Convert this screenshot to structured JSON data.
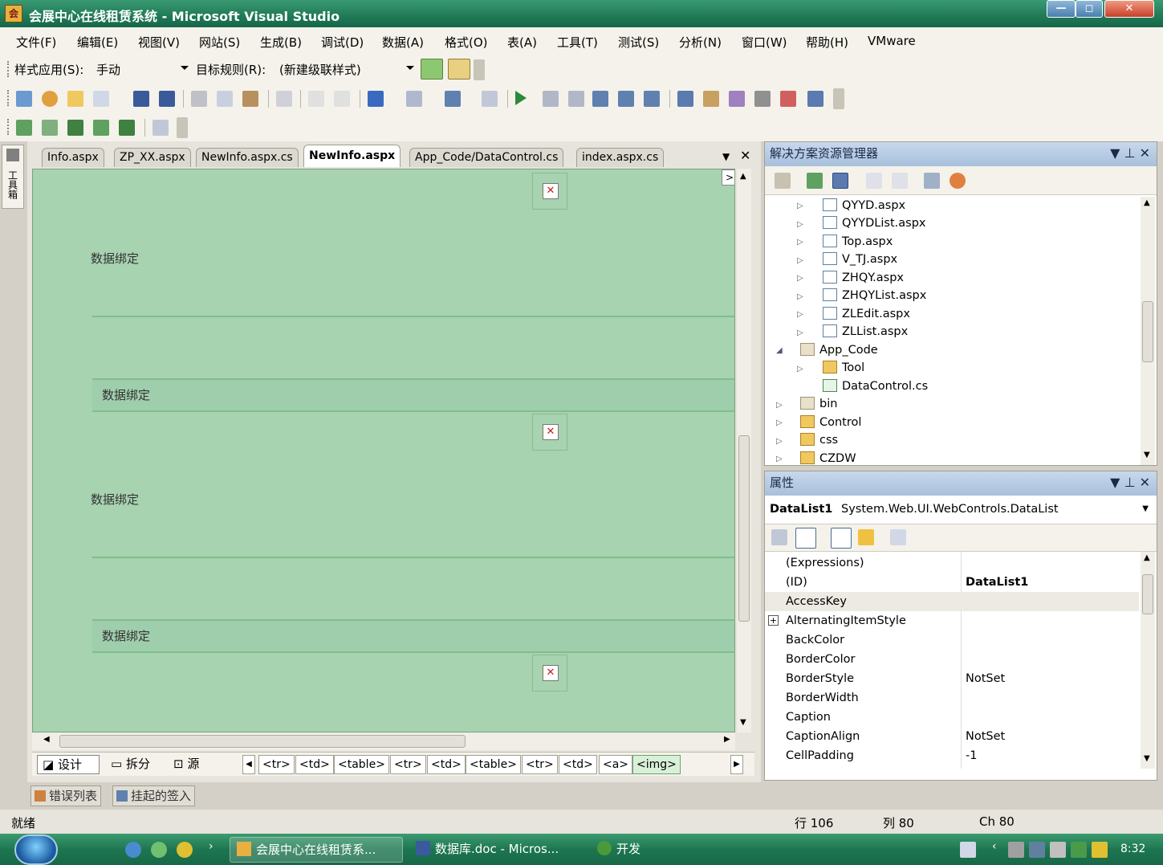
{
  "window": {
    "title": "会展中心在线租赁系统 - Microsoft Visual Studio",
    "icon_glyph": "会"
  },
  "window_buttons": {
    "minimize": "—",
    "maximize": "◻",
    "close": "✕"
  },
  "menu": [
    "文件(F)",
    "编辑(E)",
    "视图(V)",
    "网站(S)",
    "生成(B)",
    "调试(D)",
    "数据(A)",
    "格式(O)",
    "表(A)",
    "工具(T)",
    "测试(S)",
    "分析(N)",
    "窗口(W)",
    "帮助(H)",
    "VMware"
  ],
  "style_toolbar": {
    "style_apply_label": "样式应用(S):",
    "style_apply_value": "手动",
    "target_rule_label": "目标规则(R):",
    "target_rule_value": "(新建级联样式)"
  },
  "toolbox_strip": {
    "icon": "toolbox-icon",
    "label": "工具箱"
  },
  "doc_tabs": [
    {
      "label": "Info.aspx",
      "active": false
    },
    {
      "label": "ZP_XX.aspx",
      "active": false
    },
    {
      "label": "NewInfo.aspx.cs",
      "active": false
    },
    {
      "label": "NewInfo.aspx",
      "active": true
    },
    {
      "label": "App_Code/DataControl.cs",
      "active": false
    },
    {
      "label": "index.aspx.cs",
      "active": false
    }
  ],
  "design_surface": {
    "bind_labels": [
      "数据绑定",
      "数据绑定",
      "数据绑定",
      "数据绑定"
    ],
    "image_placeholder": "✕",
    "smart_tag": ">"
  },
  "view_buttons": {
    "design": "设计",
    "split": "拆分",
    "source": "源"
  },
  "tag_path": [
    "<tr>",
    "<td>",
    "<table>",
    "<tr>",
    "<td>",
    "<table>",
    "<tr>",
    "<td>",
    "<a>",
    "<img>"
  ],
  "solution_explorer": {
    "title": "解决方案资源管理器",
    "items": [
      {
        "label": "QYYD.aspx",
        "kind": "file"
      },
      {
        "label": "QYYDList.aspx",
        "kind": "file"
      },
      {
        "label": "Top.aspx",
        "kind": "file"
      },
      {
        "label": "V_TJ.aspx",
        "kind": "file"
      },
      {
        "label": "ZHQY.aspx",
        "kind": "file"
      },
      {
        "label": "ZHQYList.aspx",
        "kind": "file"
      },
      {
        "label": "ZLEdit.aspx",
        "kind": "file"
      },
      {
        "label": "ZLList.aspx",
        "kind": "file"
      },
      {
        "label": "App_Code",
        "kind": "openfolder"
      },
      {
        "label": "Tool",
        "kind": "folder"
      },
      {
        "label": "DataControl.cs",
        "kind": "cs"
      },
      {
        "label": "bin",
        "kind": "openfolder"
      },
      {
        "label": "Control",
        "kind": "folder"
      },
      {
        "label": "css",
        "kind": "folder"
      },
      {
        "label": "CZDW",
        "kind": "folder"
      }
    ]
  },
  "properties": {
    "title": "属性",
    "object_name": "DataList1",
    "object_type": "System.Web.UI.WebControls.DataList",
    "rows": [
      {
        "name": "(Expressions)",
        "value": ""
      },
      {
        "name": "(ID)",
        "value": "DataList1"
      },
      {
        "name": "AccessKey",
        "value": ""
      },
      {
        "name": "AlternatingItemStyle",
        "value": ""
      },
      {
        "name": "BackColor",
        "value": ""
      },
      {
        "name": "BorderColor",
        "value": ""
      },
      {
        "name": "BorderStyle",
        "value": "NotSet"
      },
      {
        "name": "BorderWidth",
        "value": ""
      },
      {
        "name": "Caption",
        "value": ""
      },
      {
        "name": "CaptionAlign",
        "value": "NotSet"
      },
      {
        "name": "CellPadding",
        "value": "-1"
      }
    ]
  },
  "bottom_tabs": {
    "errors": "错误列表",
    "pending": "挂起的签入"
  },
  "status": {
    "text": "就绪",
    "line": "行 106",
    "col": "列 80",
    "ch": "Ch 80"
  },
  "taskbar": {
    "items": [
      {
        "label": "会展中心在线租赁系...",
        "active": true
      },
      {
        "label": "数据库.doc - Micros...",
        "active": false
      },
      {
        "label": "开发",
        "active": false
      }
    ],
    "clock": "8:32"
  },
  "colors": {
    "design_bg": "#a7d3b0",
    "titlebar": "#1f7a55",
    "panel_header": "#a8c0dc"
  }
}
